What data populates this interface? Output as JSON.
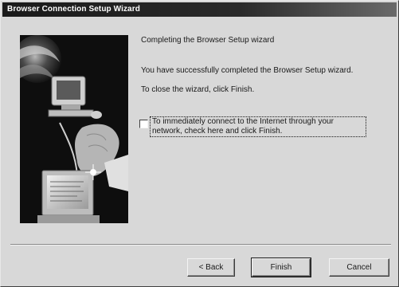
{
  "window": {
    "title": "Browser Connection Setup Wizard"
  },
  "side_image": {
    "description_icon": "computer-setup-illustration"
  },
  "content": {
    "heading": "Completing the Browser Setup wizard",
    "message_success": "You have successfully completed the Browser Setup wizard.",
    "message_close": "To close the wizard, click Finish.",
    "checkbox_label": "To immediately connect to the Internet through your network, check here and click Finish.",
    "checkbox_checked": false
  },
  "buttons": {
    "back": "< Back",
    "finish": "Finish",
    "cancel": "Cancel"
  },
  "colors": {
    "dialog_bg": "#d8d8d8",
    "titlebar_bg": "#1a1a1a",
    "titlebar_text": "#ffffff"
  }
}
